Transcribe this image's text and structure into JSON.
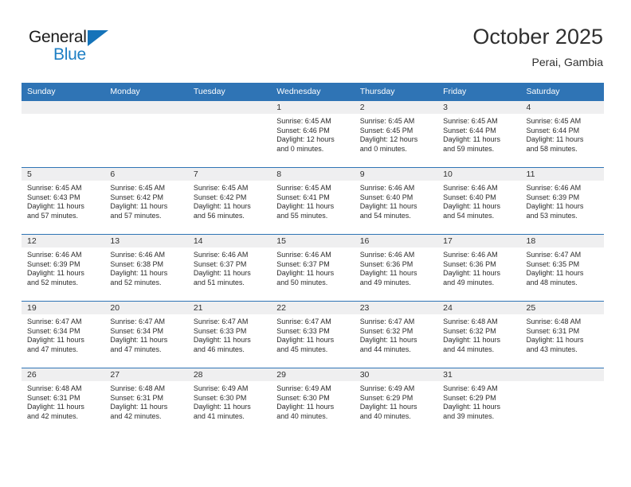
{
  "brand": {
    "name_top": "General",
    "name_bottom": "Blue",
    "accent_color": "#1e7fc4"
  },
  "header": {
    "title": "October 2025",
    "subtitle": "Perai, Gambia"
  },
  "theme": {
    "header_bg": "#2f74b5",
    "daynum_bg": "#efeff0",
    "text": "#2b2b2b"
  },
  "weekday_headers": [
    "Sunday",
    "Monday",
    "Tuesday",
    "Wednesday",
    "Thursday",
    "Friday",
    "Saturday"
  ],
  "weeks": [
    [
      {
        "day": "",
        "sunrise": "",
        "sunset": "",
        "daylight_line1": "",
        "daylight_line2": ""
      },
      {
        "day": "",
        "sunrise": "",
        "sunset": "",
        "daylight_line1": "",
        "daylight_line2": ""
      },
      {
        "day": "",
        "sunrise": "",
        "sunset": "",
        "daylight_line1": "",
        "daylight_line2": ""
      },
      {
        "day": "1",
        "sunrise": "Sunrise: 6:45 AM",
        "sunset": "Sunset: 6:46 PM",
        "daylight_line1": "Daylight: 12 hours",
        "daylight_line2": "and 0 minutes."
      },
      {
        "day": "2",
        "sunrise": "Sunrise: 6:45 AM",
        "sunset": "Sunset: 6:45 PM",
        "daylight_line1": "Daylight: 12 hours",
        "daylight_line2": "and 0 minutes."
      },
      {
        "day": "3",
        "sunrise": "Sunrise: 6:45 AM",
        "sunset": "Sunset: 6:44 PM",
        "daylight_line1": "Daylight: 11 hours",
        "daylight_line2": "and 59 minutes."
      },
      {
        "day": "4",
        "sunrise": "Sunrise: 6:45 AM",
        "sunset": "Sunset: 6:44 PM",
        "daylight_line1": "Daylight: 11 hours",
        "daylight_line2": "and 58 minutes."
      }
    ],
    [
      {
        "day": "5",
        "sunrise": "Sunrise: 6:45 AM",
        "sunset": "Sunset: 6:43 PM",
        "daylight_line1": "Daylight: 11 hours",
        "daylight_line2": "and 57 minutes."
      },
      {
        "day": "6",
        "sunrise": "Sunrise: 6:45 AM",
        "sunset": "Sunset: 6:42 PM",
        "daylight_line1": "Daylight: 11 hours",
        "daylight_line2": "and 57 minutes."
      },
      {
        "day": "7",
        "sunrise": "Sunrise: 6:45 AM",
        "sunset": "Sunset: 6:42 PM",
        "daylight_line1": "Daylight: 11 hours",
        "daylight_line2": "and 56 minutes."
      },
      {
        "day": "8",
        "sunrise": "Sunrise: 6:45 AM",
        "sunset": "Sunset: 6:41 PM",
        "daylight_line1": "Daylight: 11 hours",
        "daylight_line2": "and 55 minutes."
      },
      {
        "day": "9",
        "sunrise": "Sunrise: 6:46 AM",
        "sunset": "Sunset: 6:40 PM",
        "daylight_line1": "Daylight: 11 hours",
        "daylight_line2": "and 54 minutes."
      },
      {
        "day": "10",
        "sunrise": "Sunrise: 6:46 AM",
        "sunset": "Sunset: 6:40 PM",
        "daylight_line1": "Daylight: 11 hours",
        "daylight_line2": "and 54 minutes."
      },
      {
        "day": "11",
        "sunrise": "Sunrise: 6:46 AM",
        "sunset": "Sunset: 6:39 PM",
        "daylight_line1": "Daylight: 11 hours",
        "daylight_line2": "and 53 minutes."
      }
    ],
    [
      {
        "day": "12",
        "sunrise": "Sunrise: 6:46 AM",
        "sunset": "Sunset: 6:39 PM",
        "daylight_line1": "Daylight: 11 hours",
        "daylight_line2": "and 52 minutes."
      },
      {
        "day": "13",
        "sunrise": "Sunrise: 6:46 AM",
        "sunset": "Sunset: 6:38 PM",
        "daylight_line1": "Daylight: 11 hours",
        "daylight_line2": "and 52 minutes."
      },
      {
        "day": "14",
        "sunrise": "Sunrise: 6:46 AM",
        "sunset": "Sunset: 6:37 PM",
        "daylight_line1": "Daylight: 11 hours",
        "daylight_line2": "and 51 minutes."
      },
      {
        "day": "15",
        "sunrise": "Sunrise: 6:46 AM",
        "sunset": "Sunset: 6:37 PM",
        "daylight_line1": "Daylight: 11 hours",
        "daylight_line2": "and 50 minutes."
      },
      {
        "day": "16",
        "sunrise": "Sunrise: 6:46 AM",
        "sunset": "Sunset: 6:36 PM",
        "daylight_line1": "Daylight: 11 hours",
        "daylight_line2": "and 49 minutes."
      },
      {
        "day": "17",
        "sunrise": "Sunrise: 6:46 AM",
        "sunset": "Sunset: 6:36 PM",
        "daylight_line1": "Daylight: 11 hours",
        "daylight_line2": "and 49 minutes."
      },
      {
        "day": "18",
        "sunrise": "Sunrise: 6:47 AM",
        "sunset": "Sunset: 6:35 PM",
        "daylight_line1": "Daylight: 11 hours",
        "daylight_line2": "and 48 minutes."
      }
    ],
    [
      {
        "day": "19",
        "sunrise": "Sunrise: 6:47 AM",
        "sunset": "Sunset: 6:34 PM",
        "daylight_line1": "Daylight: 11 hours",
        "daylight_line2": "and 47 minutes."
      },
      {
        "day": "20",
        "sunrise": "Sunrise: 6:47 AM",
        "sunset": "Sunset: 6:34 PM",
        "daylight_line1": "Daylight: 11 hours",
        "daylight_line2": "and 47 minutes."
      },
      {
        "day": "21",
        "sunrise": "Sunrise: 6:47 AM",
        "sunset": "Sunset: 6:33 PM",
        "daylight_line1": "Daylight: 11 hours",
        "daylight_line2": "and 46 minutes."
      },
      {
        "day": "22",
        "sunrise": "Sunrise: 6:47 AM",
        "sunset": "Sunset: 6:33 PM",
        "daylight_line1": "Daylight: 11 hours",
        "daylight_line2": "and 45 minutes."
      },
      {
        "day": "23",
        "sunrise": "Sunrise: 6:47 AM",
        "sunset": "Sunset: 6:32 PM",
        "daylight_line1": "Daylight: 11 hours",
        "daylight_line2": "and 44 minutes."
      },
      {
        "day": "24",
        "sunrise": "Sunrise: 6:48 AM",
        "sunset": "Sunset: 6:32 PM",
        "daylight_line1": "Daylight: 11 hours",
        "daylight_line2": "and 44 minutes."
      },
      {
        "day": "25",
        "sunrise": "Sunrise: 6:48 AM",
        "sunset": "Sunset: 6:31 PM",
        "daylight_line1": "Daylight: 11 hours",
        "daylight_line2": "and 43 minutes."
      }
    ],
    [
      {
        "day": "26",
        "sunrise": "Sunrise: 6:48 AM",
        "sunset": "Sunset: 6:31 PM",
        "daylight_line1": "Daylight: 11 hours",
        "daylight_line2": "and 42 minutes."
      },
      {
        "day": "27",
        "sunrise": "Sunrise: 6:48 AM",
        "sunset": "Sunset: 6:31 PM",
        "daylight_line1": "Daylight: 11 hours",
        "daylight_line2": "and 42 minutes."
      },
      {
        "day": "28",
        "sunrise": "Sunrise: 6:49 AM",
        "sunset": "Sunset: 6:30 PM",
        "daylight_line1": "Daylight: 11 hours",
        "daylight_line2": "and 41 minutes."
      },
      {
        "day": "29",
        "sunrise": "Sunrise: 6:49 AM",
        "sunset": "Sunset: 6:30 PM",
        "daylight_line1": "Daylight: 11 hours",
        "daylight_line2": "and 40 minutes."
      },
      {
        "day": "30",
        "sunrise": "Sunrise: 6:49 AM",
        "sunset": "Sunset: 6:29 PM",
        "daylight_line1": "Daylight: 11 hours",
        "daylight_line2": "and 40 minutes."
      },
      {
        "day": "31",
        "sunrise": "Sunrise: 6:49 AM",
        "sunset": "Sunset: 6:29 PM",
        "daylight_line1": "Daylight: 11 hours",
        "daylight_line2": "and 39 minutes."
      },
      {
        "day": "",
        "sunrise": "",
        "sunset": "",
        "daylight_line1": "",
        "daylight_line2": ""
      }
    ]
  ]
}
